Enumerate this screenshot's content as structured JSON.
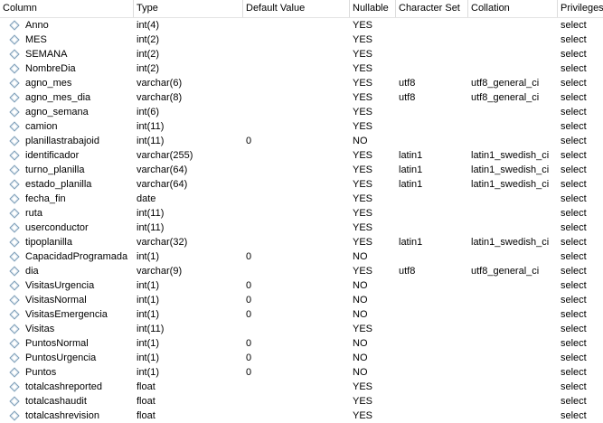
{
  "headers": {
    "column": "Column",
    "type": "Type",
    "default": "Default Value",
    "nullable": "Nullable",
    "charset": "Character Set",
    "collation": "Collation",
    "privileges": "Privileges"
  },
  "rows": [
    {
      "column": "Anno",
      "type": "int(4)",
      "default": "",
      "nullable": "YES",
      "charset": "",
      "collation": "",
      "privileges": "select"
    },
    {
      "column": "MES",
      "type": "int(2)",
      "default": "",
      "nullable": "YES",
      "charset": "",
      "collation": "",
      "privileges": "select"
    },
    {
      "column": "SEMANA",
      "type": "int(2)",
      "default": "",
      "nullable": "YES",
      "charset": "",
      "collation": "",
      "privileges": "select"
    },
    {
      "column": "NombreDia",
      "type": "int(2)",
      "default": "",
      "nullable": "YES",
      "charset": "",
      "collation": "",
      "privileges": "select"
    },
    {
      "column": "agno_mes",
      "type": "varchar(6)",
      "default": "",
      "nullable": "YES",
      "charset": "utf8",
      "collation": "utf8_general_ci",
      "privileges": "select"
    },
    {
      "column": "agno_mes_dia",
      "type": "varchar(8)",
      "default": "",
      "nullable": "YES",
      "charset": "utf8",
      "collation": "utf8_general_ci",
      "privileges": "select"
    },
    {
      "column": "agno_semana",
      "type": "int(6)",
      "default": "",
      "nullable": "YES",
      "charset": "",
      "collation": "",
      "privileges": "select"
    },
    {
      "column": "camion",
      "type": "int(11)",
      "default": "",
      "nullable": "YES",
      "charset": "",
      "collation": "",
      "privileges": "select"
    },
    {
      "column": "planillastrabajoid",
      "type": "int(11)",
      "default": "0",
      "nullable": "NO",
      "charset": "",
      "collation": "",
      "privileges": "select"
    },
    {
      "column": "identificador",
      "type": "varchar(255)",
      "default": "",
      "nullable": "YES",
      "charset": "latin1",
      "collation": "latin1_swedish_ci",
      "privileges": "select"
    },
    {
      "column": "turno_planilla",
      "type": "varchar(64)",
      "default": "",
      "nullable": "YES",
      "charset": "latin1",
      "collation": "latin1_swedish_ci",
      "privileges": "select"
    },
    {
      "column": "estado_planilla",
      "type": "varchar(64)",
      "default": "",
      "nullable": "YES",
      "charset": "latin1",
      "collation": "latin1_swedish_ci",
      "privileges": "select"
    },
    {
      "column": "fecha_fin",
      "type": "date",
      "default": "",
      "nullable": "YES",
      "charset": "",
      "collation": "",
      "privileges": "select"
    },
    {
      "column": "ruta",
      "type": "int(11)",
      "default": "",
      "nullable": "YES",
      "charset": "",
      "collation": "",
      "privileges": "select"
    },
    {
      "column": "userconductor",
      "type": "int(11)",
      "default": "",
      "nullable": "YES",
      "charset": "",
      "collation": "",
      "privileges": "select"
    },
    {
      "column": "tipoplanilla",
      "type": "varchar(32)",
      "default": "",
      "nullable": "YES",
      "charset": "latin1",
      "collation": "latin1_swedish_ci",
      "privileges": "select"
    },
    {
      "column": "CapacidadProgramada",
      "type": "int(1)",
      "default": "0",
      "nullable": "NO",
      "charset": "",
      "collation": "",
      "privileges": "select"
    },
    {
      "column": "dia",
      "type": "varchar(9)",
      "default": "",
      "nullable": "YES",
      "charset": "utf8",
      "collation": "utf8_general_ci",
      "privileges": "select"
    },
    {
      "column": "VisitasUrgencia",
      "type": "int(1)",
      "default": "0",
      "nullable": "NO",
      "charset": "",
      "collation": "",
      "privileges": "select"
    },
    {
      "column": "VisitasNormal",
      "type": "int(1)",
      "default": "0",
      "nullable": "NO",
      "charset": "",
      "collation": "",
      "privileges": "select"
    },
    {
      "column": "VisitasEmergencia",
      "type": "int(1)",
      "default": "0",
      "nullable": "NO",
      "charset": "",
      "collation": "",
      "privileges": "select"
    },
    {
      "column": "Visitas",
      "type": "int(11)",
      "default": "",
      "nullable": "YES",
      "charset": "",
      "collation": "",
      "privileges": "select"
    },
    {
      "column": "PuntosNormal",
      "type": "int(1)",
      "default": "0",
      "nullable": "NO",
      "charset": "",
      "collation": "",
      "privileges": "select"
    },
    {
      "column": "PuntosUrgencia",
      "type": "int(1)",
      "default": "0",
      "nullable": "NO",
      "charset": "",
      "collation": "",
      "privileges": "select"
    },
    {
      "column": "Puntos",
      "type": "int(1)",
      "default": "0",
      "nullable": "NO",
      "charset": "",
      "collation": "",
      "privileges": "select"
    },
    {
      "column": "totalcashreported",
      "type": "float",
      "default": "",
      "nullable": "YES",
      "charset": "",
      "collation": "",
      "privileges": "select"
    },
    {
      "column": "totalcashaudit",
      "type": "float",
      "default": "",
      "nullable": "YES",
      "charset": "",
      "collation": "",
      "privileges": "select"
    },
    {
      "column": "totalcashrevision",
      "type": "float",
      "default": "",
      "nullable": "YES",
      "charset": "",
      "collation": "",
      "privileges": "select"
    }
  ]
}
